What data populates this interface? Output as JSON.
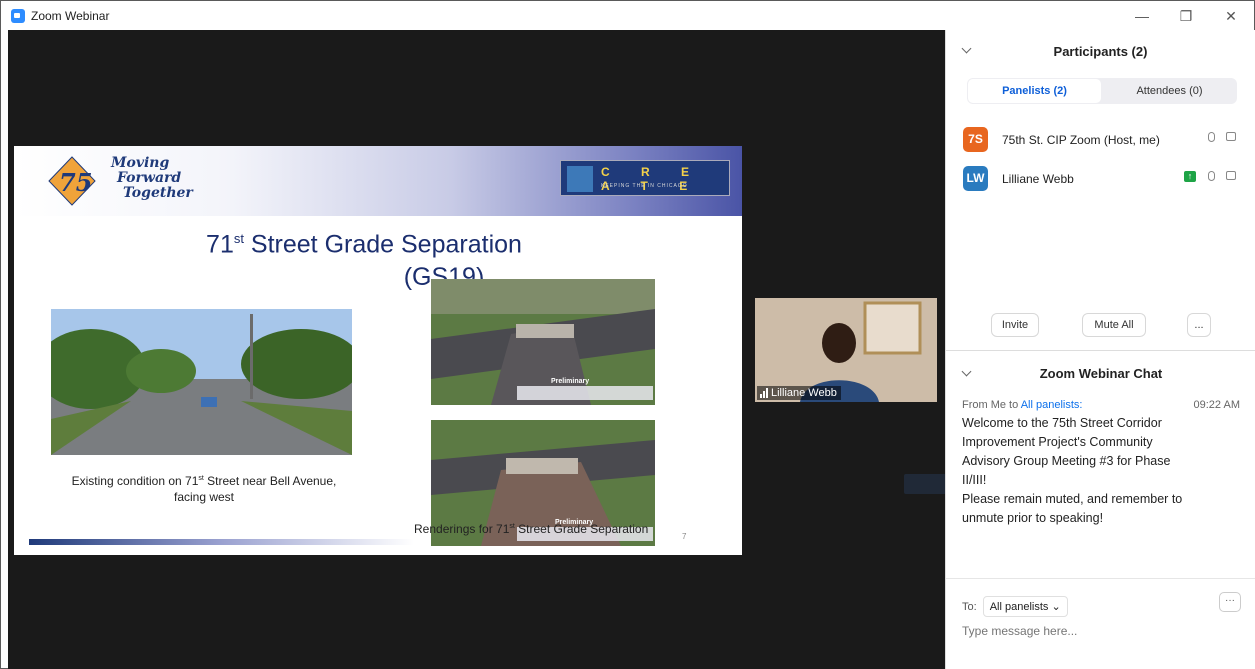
{
  "window": {
    "title": "Zoom Webinar"
  },
  "slide": {
    "tagline": [
      "Moving",
      "Forward",
      "Together"
    ],
    "create_logo": "C R E A T E",
    "create_sub": "KEEPING THE IN CHICAGO",
    "title_line1_pre": "71",
    "title_line1_sup": "st",
    "title_line1_post": " Street Grade Separation",
    "title_line2": "(GS19)",
    "caption1_pre": "Existing condition on 71",
    "caption1_sup": "st",
    "caption1_post": " Street near Bell Avenue,",
    "caption1_line2": "facing west",
    "render_label": "Preliminary",
    "caption2_pre": "Renderings for 71",
    "caption2_sup": "st",
    "caption2_post": " Street Grade Separation",
    "page_number": "7"
  },
  "video": {
    "name": "Lilliane Webb"
  },
  "participants": {
    "title": "Participants (2)",
    "tabs": [
      {
        "label": "Panelists (2)",
        "active": true
      },
      {
        "label": "Attendees (0)",
        "active": false
      }
    ],
    "list": [
      {
        "initials": "7S",
        "name": "75th St. CIP Zoom (Host, me)",
        "color": "#e8661f",
        "sharing": false
      },
      {
        "initials": "LW",
        "name": "Lilliane Webb",
        "color": "#2a7bbf",
        "sharing": true
      }
    ],
    "buttons": {
      "invite": "Invite",
      "mute_all": "Mute All",
      "more": "..."
    }
  },
  "chat": {
    "title": "Zoom Webinar Chat",
    "from": "From Me to",
    "to": "All panelists:",
    "time": "09:22 AM",
    "message_lines": [
      "Welcome to the 75th Street Corridor",
      "Improvement Project's Community",
      "Advisory Group Meeting #3 for Phase",
      "II/III!",
      "Please remain muted, and remember to",
      "unmute prior to speaking!"
    ],
    "to_label": "To:",
    "to_value": "All panelists",
    "more": "···",
    "placeholder": "Type message here..."
  },
  "colors": {
    "accent": "#0e71eb",
    "stage": "#1a1a1a",
    "host_avatar": "#e8661f",
    "panelist_avatar": "#2a7bbf"
  },
  "icons": [
    "app-icon",
    "minimize-icon",
    "restore-icon",
    "close-icon",
    "chevron-down-icon",
    "microphone-icon",
    "camera-icon",
    "screen-share-icon",
    "signal-icon"
  ]
}
